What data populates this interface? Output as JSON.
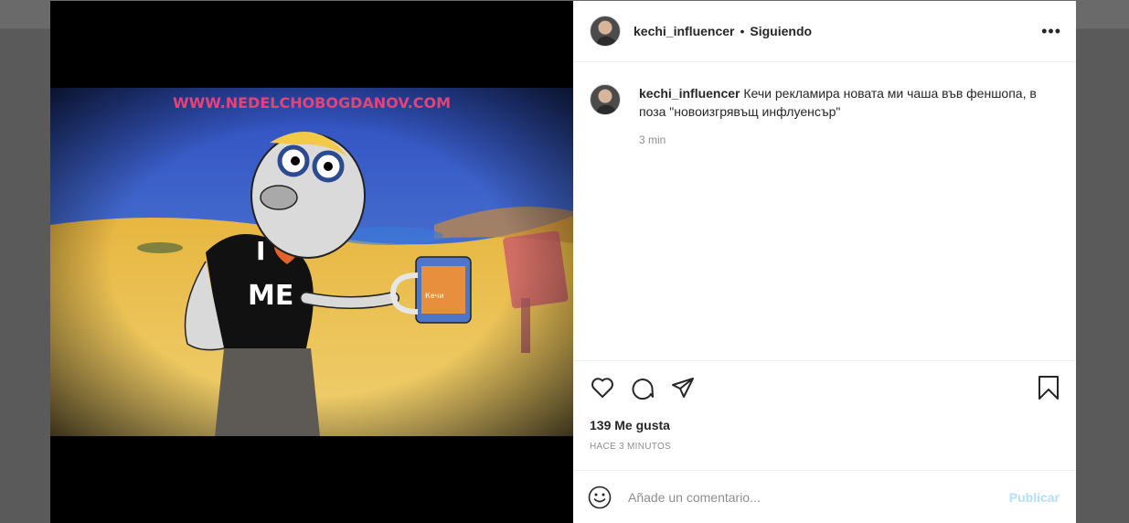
{
  "post": {
    "username": "kechi_influencer",
    "separator": "•",
    "follow_label": "Siguiendo",
    "more_label": "•••",
    "image_watermark": "WWW.NEDELCHOBOGDANOV.COM",
    "shirt_text_i": "I",
    "shirt_text_me": "ME",
    "mug_label": "Кечи"
  },
  "caption": {
    "username": "kechi_influencer",
    "text": "Кечи рекламира новата ми чаша във феншопа, в поза \"новоизгрявъщ инфлуенсър\"",
    "time": "3 min"
  },
  "stats": {
    "likes": "139 Me gusta",
    "posted_ago": "HACE 3 MINUTOS"
  },
  "comment_box": {
    "placeholder": "Añade un comentario...",
    "publish_label": "Publicar"
  },
  "icons": [
    "heart-icon",
    "comment-icon",
    "share-icon",
    "bookmark-icon",
    "emoji-icon",
    "more-icon"
  ]
}
